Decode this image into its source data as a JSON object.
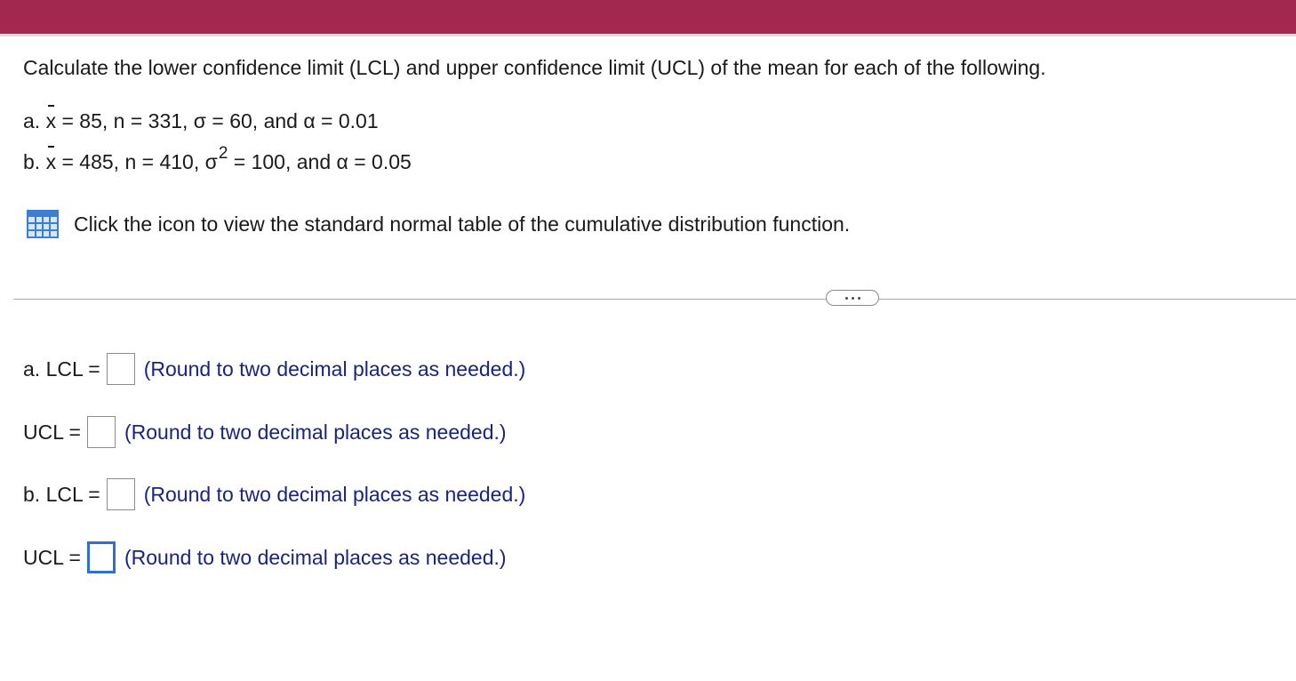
{
  "question": {
    "title": "Calculate the lower confidence limit (LCL) and upper confidence limit (UCL) of the mean for each of the following.",
    "part_a": {
      "prefix": "a.",
      "x_symbol": "x",
      "rest": "= 85,  n = 331,  σ = 60,  and  α = 0.01"
    },
    "part_b": {
      "prefix": "b.",
      "x_symbol": "x",
      "mid": "= 485,  n = 410,  σ",
      "exponent": "2",
      "rest": " = 100,  and  α = 0.05"
    },
    "table_link_text": "Click the icon to view the standard normal table of the cumulative distribution function."
  },
  "answers": [
    {
      "label": "a. LCL =",
      "hint": "(Round to two decimal places as needed.)",
      "value": ""
    },
    {
      "label": "UCL =",
      "hint": "(Round to two decimal places as needed.)",
      "value": ""
    },
    {
      "label": "b. LCL =",
      "hint": "(Round to two decimal places as needed.)",
      "value": ""
    },
    {
      "label": "UCL =",
      "hint": "(Round to two decimal places as needed.)",
      "value": ""
    }
  ],
  "colors": {
    "header": "#a3284f",
    "hint_text": "#1a237e",
    "active_input_border": "#2f6fd0",
    "table_icon": "#3b7fd4"
  },
  "icons": {
    "table": "table-grid-icon",
    "more": "ellipsis-icon"
  }
}
